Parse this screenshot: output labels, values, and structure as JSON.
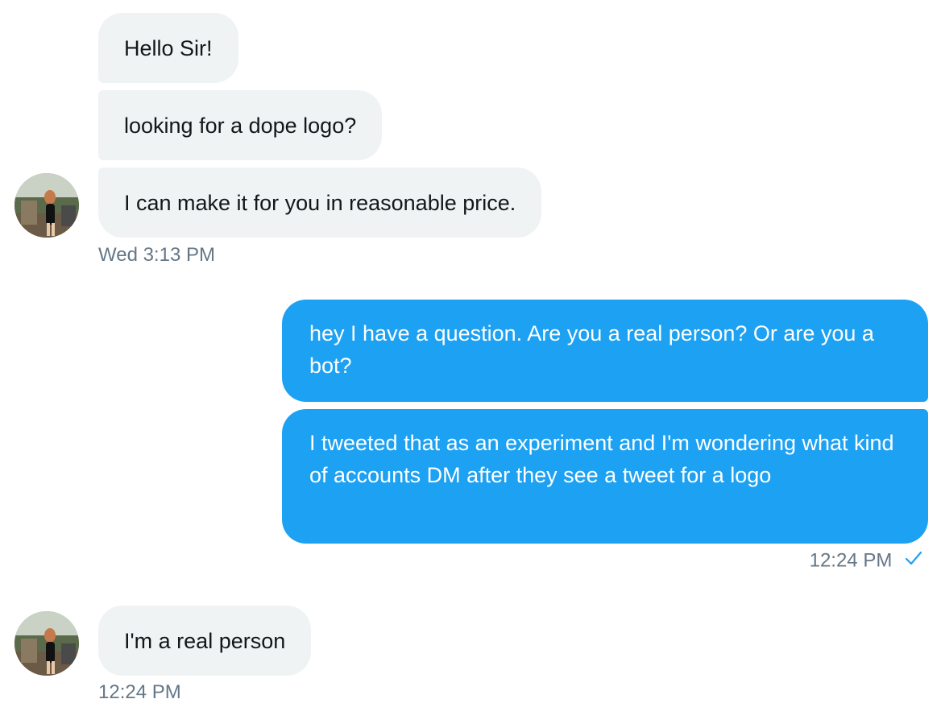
{
  "conversation": {
    "group1": {
      "messages": [
        "Hello Sir!",
        "looking for a dope logo?",
        "I can make it for you in reasonable price."
      ],
      "timestamp": "Wed 3:13 PM"
    },
    "group2": {
      "messages": [
        "hey I have a question. Are you a real person? Or are you a bot?",
        "I tweeted that as an experiment and I'm wondering what kind of accounts DM after they see a tweet for a logo"
      ],
      "timestamp": "12:24 PM"
    },
    "group3": {
      "messages": [
        "I'm a real person"
      ],
      "timestamp": "12:24 PM"
    }
  },
  "colors": {
    "incoming_bubble": "#eff3f4",
    "outgoing_bubble": "#1da1f2",
    "timestamp": "#657786",
    "read_check": "#1da1f2"
  },
  "icons": {
    "read_receipt": "checkmark-icon",
    "avatar": "user-avatar"
  }
}
